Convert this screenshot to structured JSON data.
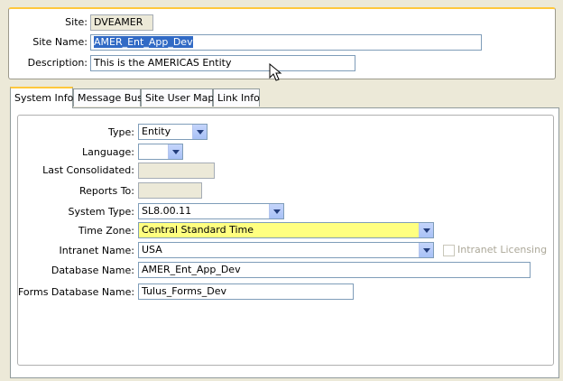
{
  "header": {
    "site_label": "Site:",
    "site_value": "DVEAMER",
    "site_name_label": "Site Name:",
    "site_name_value": "AMER_Ent_App_Dev",
    "description_label": "Description:",
    "description_value": "This is the AMERICAS Entity"
  },
  "tabs": [
    {
      "label": "System Info",
      "active": true
    },
    {
      "label": "Message Bus",
      "active": false
    },
    {
      "label": "Site User Map",
      "active": false
    },
    {
      "label": "Link Info",
      "active": false
    }
  ],
  "system_info": {
    "type_label": "Type:",
    "type_value": "Entity",
    "language_label": "Language:",
    "language_value": "",
    "last_consolidated_label": "Last Consolidated:",
    "last_consolidated_value": "",
    "reports_to_label": "Reports To:",
    "reports_to_value": "",
    "system_type_label": "System Type:",
    "system_type_value": "SL8.00.11",
    "time_zone_label": "Time Zone:",
    "time_zone_value": "Central Standard Time",
    "intranet_name_label": "Intranet Name:",
    "intranet_name_value": "USA",
    "intranet_licensing_label": "Intranet Licensing",
    "intranet_licensing_checked": false,
    "database_name_label": "Database Name:",
    "database_name_value": "AMER_Ent_App_Dev",
    "forms_database_name_label": "Forms Database Name:",
    "forms_database_name_value": "Tulus_Forms_Dev"
  },
  "colors": {
    "accent_tab": "#ffc83c",
    "time_zone_highlight": "#ffff80",
    "selection": "#316ac5"
  },
  "icons": [
    "chevron-down-icon",
    "mouse-cursor-icon",
    "checkbox-icon"
  ]
}
